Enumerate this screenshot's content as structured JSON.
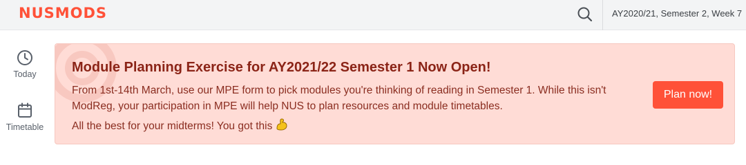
{
  "header": {
    "logo": "NUSMODS",
    "search_icon": "search-icon",
    "semester_label": "AY2020/21, Semester 2, Week 7"
  },
  "sidebar": {
    "items": [
      {
        "label": "Today",
        "icon": "clock-icon"
      },
      {
        "label": "Timetable",
        "icon": "calendar-icon"
      }
    ]
  },
  "banner": {
    "title": "Module Planning Exercise for AY2021/22 Semester 1 Now Open!",
    "body": "From 1st-14th March, use our MPE form to pick modules you're thinking of reading in Semester 1. While this isn't ModReg, your participation in MPE will help NUS to plan resources and module timetables.",
    "note": "All the best for your midterms! You got this",
    "note_icon": "flexed-biceps-icon",
    "button_label": "Plan now!"
  },
  "colors": {
    "brand": "#ff5138",
    "banner_bg": "#ffdcd6",
    "banner_text": "#8b2417"
  }
}
